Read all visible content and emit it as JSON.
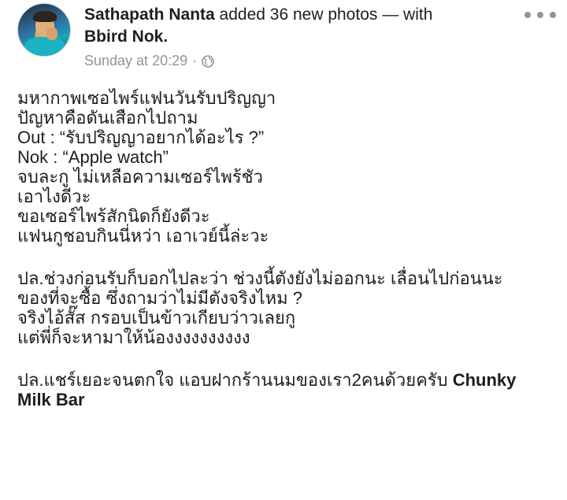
{
  "post": {
    "author": "Sathapath Nanta",
    "action_text": " added 36 new photos — with",
    "tagged_user": "Bbird Nok",
    "tagged_suffix": ".",
    "timestamp": "Sunday at 20:29",
    "separator": "·",
    "privacy_icon": "globe-icon",
    "more_icon": "more-options-icon"
  },
  "body": {
    "paragraph1": [
      "มหากาพเซอไพร์แฟนวันรับปริญญา",
      "ปัญหาคือดันเสือกไปถาม",
      "Out : “รับปริญญาอยากได้อะไร ?”",
      "Nok : “Apple watch”",
      "จบละกู ไม่เหลือความเซอร์ไพร้ชัว",
      "เอาไงดีวะ",
      "ขอเซอร์ไพร้สักนิดก็ยังดีวะ",
      "แฟนกูชอบกินนี่หว่า เอาเวย์นี้ล่ะวะ"
    ],
    "paragraph2": [
      "ปล.ช่วงก่อนรับก็บอกไปละว่า ช่วงนี้ตังยังไม่ออกนะ เลื่อนไปก่อนนะ",
      "ของที่จะซื้อ ซึ่งถามว่าไม่มีตังจริงไหม ?",
      "จริงไอ้สั๊ส กรอบเป็นข้าวเกียบว่าวเลยกู",
      "แต่พี่ก็จะหามาให้น้องงงงงงงงงง"
    ],
    "paragraph3_prefix": "ปล.แชร์เยอะจนตกใจ แอบฝากร้านนมของเรา2คนด้วยครับ ",
    "paragraph3_bold_1": "Chunky",
    "paragraph3_bold_2": "Milk Bar"
  }
}
